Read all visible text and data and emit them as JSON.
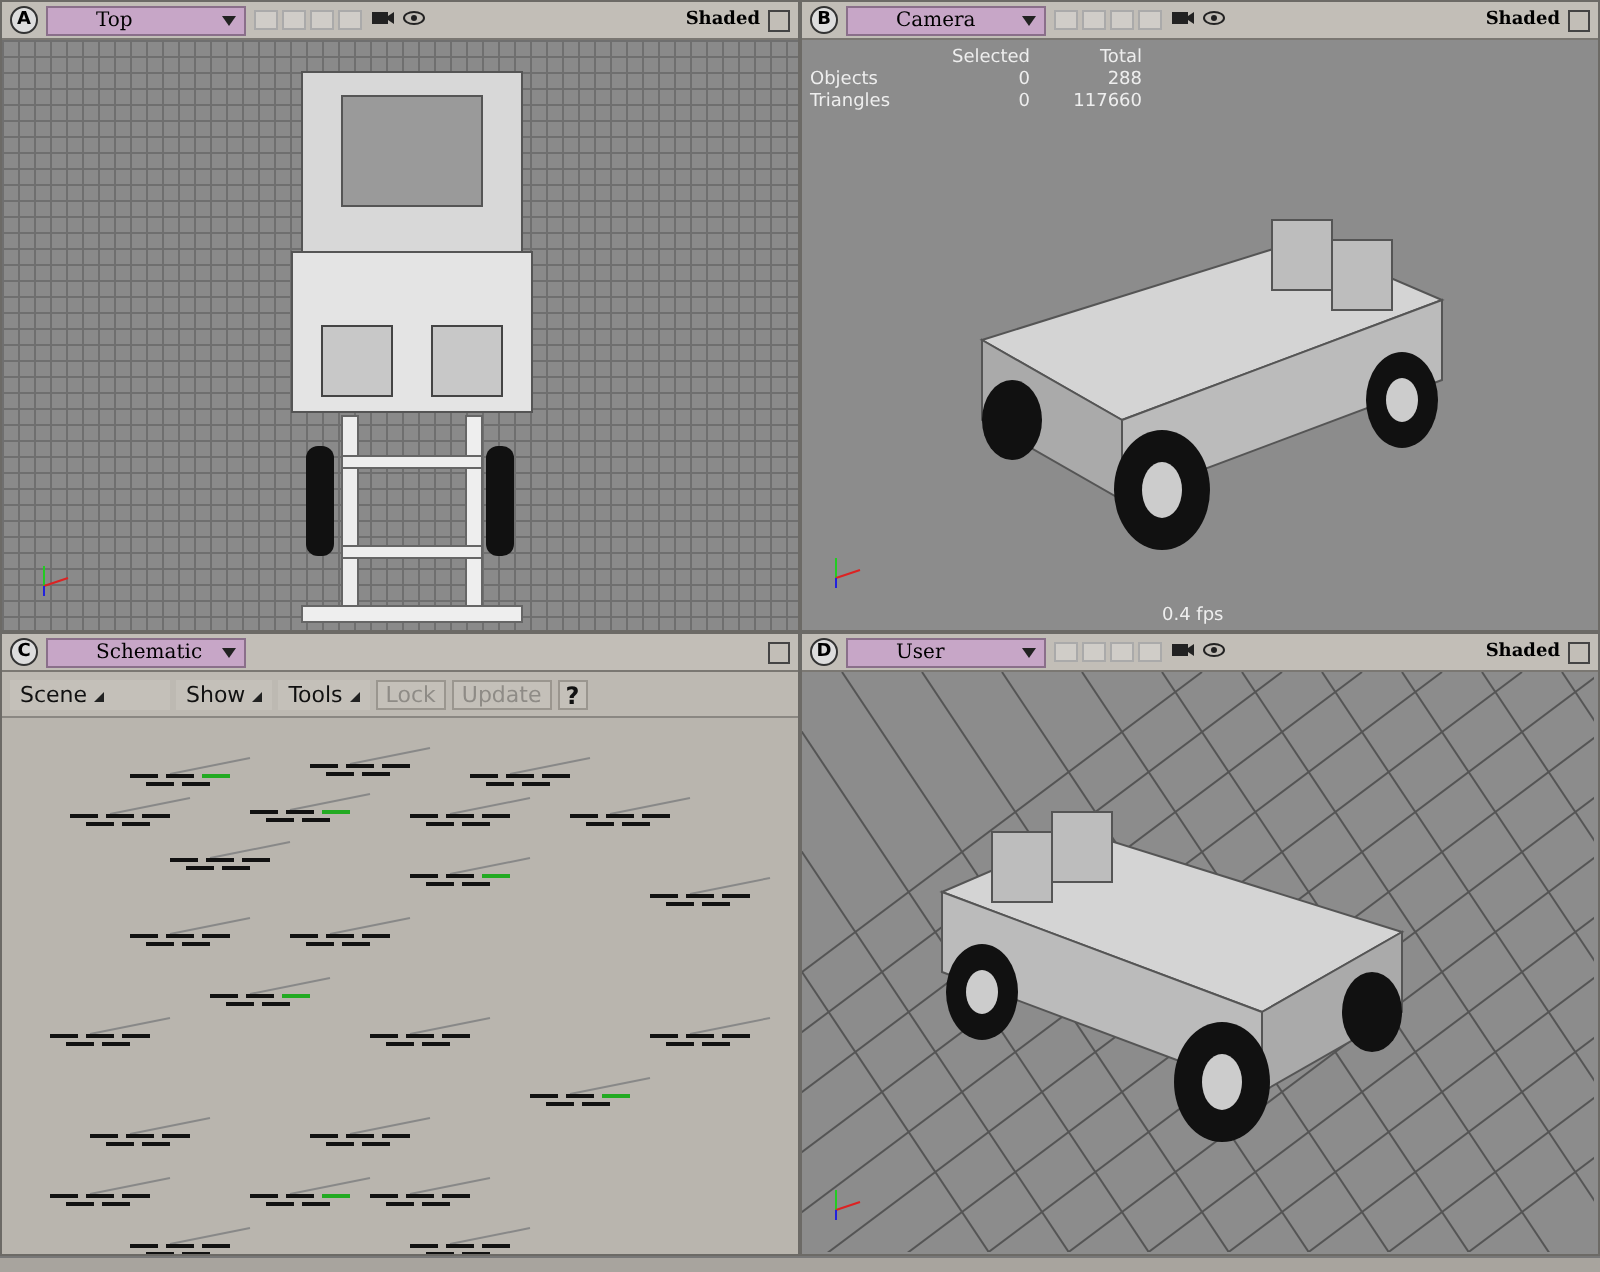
{
  "viewports": [
    {
      "kind": "top",
      "letter": "A",
      "view": "Top",
      "shading": "Shaded"
    },
    {
      "kind": "camera",
      "letter": "B",
      "view": "Camera",
      "shading": "Shaded",
      "stats": {
        "columns": [
          "Selected",
          "Total"
        ],
        "rows": [
          {
            "label": "Objects",
            "selected": "0",
            "total": "288"
          },
          {
            "label": "Triangles",
            "selected": "0",
            "total": "117660"
          }
        ]
      },
      "fps": "0.4  fps"
    },
    {
      "kind": "schematic",
      "letter": "C",
      "view": "Schematic",
      "toolbar": [
        {
          "label": "Scene",
          "kind": "menu",
          "disabled": false
        },
        {
          "label": "Show",
          "kind": "menu",
          "disabled": false
        },
        {
          "label": "Tools",
          "kind": "menu",
          "disabled": false
        },
        {
          "label": "Lock",
          "kind": "button",
          "disabled": true
        },
        {
          "label": "Update",
          "kind": "button",
          "disabled": true
        },
        {
          "label": "?",
          "kind": "help",
          "disabled": false
        }
      ]
    },
    {
      "kind": "user",
      "letter": "D",
      "view": "User",
      "shading": "Shaded"
    }
  ]
}
